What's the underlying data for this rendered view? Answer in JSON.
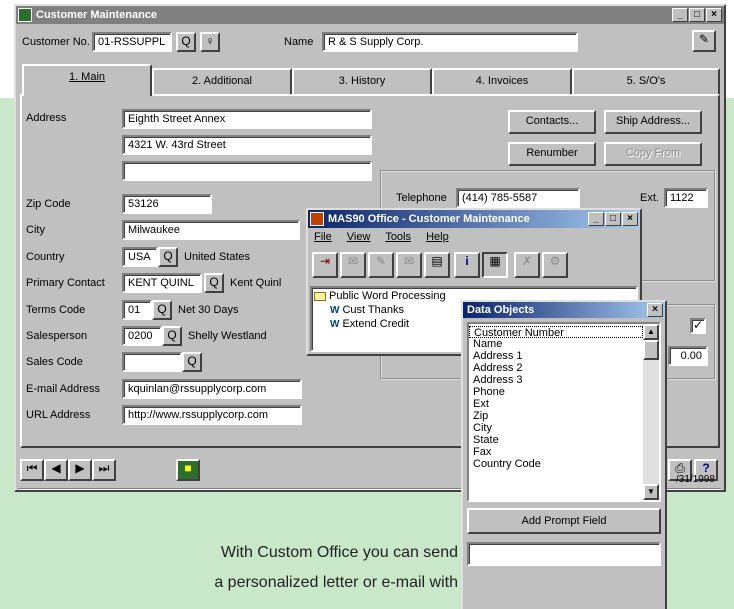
{
  "main_window": {
    "title": "Customer Maintenance",
    "customer_no_label": "Customer No.",
    "customer_no_value": "01-RSSUPPL",
    "name_label": "Name",
    "name_value": "R & S Supply Corp.",
    "tabs": [
      {
        "label": "1. Main"
      },
      {
        "label": "2. Additional"
      },
      {
        "label": "3. History"
      },
      {
        "label": "4. Invoices"
      },
      {
        "label": "5. S/O's"
      }
    ],
    "fields": {
      "address_label": "Address",
      "address1": "Eighth Street Annex",
      "address2": "4321 W. 43rd Street",
      "address3": "",
      "zip_label": "Zip Code",
      "zip": "53126",
      "city_label": "City",
      "city": "Milwaukee",
      "country_label": "Country",
      "country_code": "USA",
      "country_name": "United States",
      "contact_label": "Primary Contact",
      "contact_code": "KENT QUINL",
      "contact_name": "Kent Quinl",
      "terms_label": "Terms Code",
      "terms_code": "01",
      "terms_desc": "Net 30 Days",
      "salesperson_label": "Salesperson",
      "salesperson_code": "0200",
      "salesperson_name": "Shelly Westland",
      "salescode_label": "Sales Code",
      "salescode": "",
      "email_label": "E-mail Address",
      "email": "kquinlan@rssupplycorp.com",
      "url_label": "URL Address",
      "url": "http://www.rssupplycorp.com",
      "telephone_label": "Telephone",
      "telephone": "(414) 785-5587",
      "ext_label": "Ext.",
      "ext": "1122",
      "partial_amount": "0.00",
      "status_date": "/31/1998"
    },
    "buttons": {
      "contacts": "Contacts...",
      "ship_address": "Ship Address...",
      "renumber": "Renumber",
      "copy_from": "Copy From"
    }
  },
  "office_window": {
    "title": "MAS90 Office - Customer Maintenance",
    "menu": [
      "File",
      "View",
      "Tools",
      "Help"
    ],
    "tree": {
      "folder": "Public Word Processing",
      "items": [
        "Cust Thanks",
        "Extend Credit"
      ]
    }
  },
  "data_objects": {
    "title": "Data Objects",
    "items": [
      "Customer Number",
      "Name",
      "Address 1",
      "Address 2",
      "Address 3",
      "Phone",
      "Ext",
      "Zip",
      "City",
      "State",
      "Fax",
      "Country Code"
    ],
    "selected": "Customer Number",
    "add_button": "Add Prompt Field"
  },
  "caption": {
    "line1": "With Custom Office you can send",
    "line2": "a personalized letter or e-mail with"
  },
  "colors": {
    "accent_green": "#c9e7c9",
    "title_blue": "#0a246a"
  }
}
